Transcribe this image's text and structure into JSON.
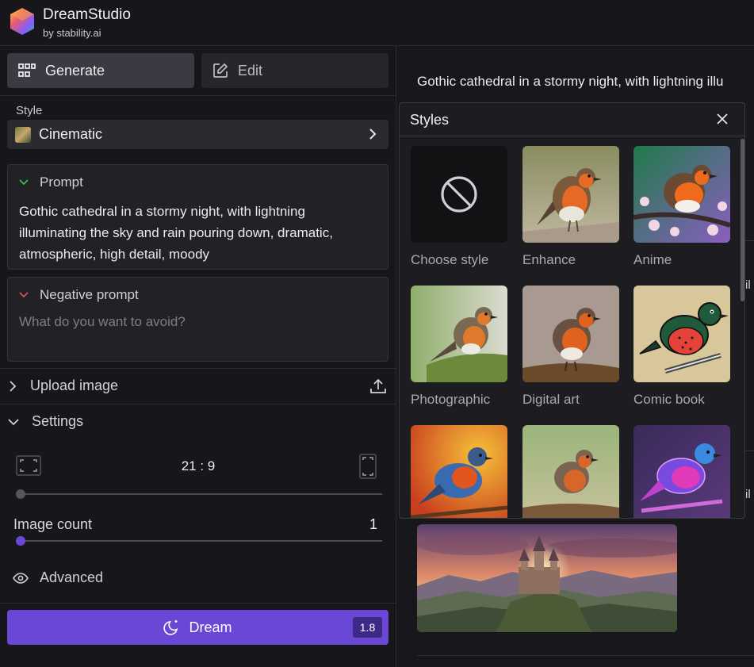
{
  "header": {
    "brand_name": "DreamStudio",
    "brand_sub": "by stability.ai"
  },
  "tabs": {
    "generate": "Generate",
    "edit": "Edit",
    "active": "Generate"
  },
  "style": {
    "label": "Style",
    "selected": "Cinematic"
  },
  "prompt": {
    "heading": "Prompt",
    "text": "Gothic cathedral in a stormy night, with lightning illuminating the sky and rain pouring down, dramatic, atmospheric, high detail, moody"
  },
  "negative_prompt": {
    "heading": "Negative prompt",
    "placeholder": "What do you want to avoid?",
    "value": ""
  },
  "upload": {
    "label": "Upload image"
  },
  "settings": {
    "label": "Settings",
    "aspect_ratio": "21 : 9",
    "aspect_ratio_fraction": 0.0,
    "image_count_label": "Image count",
    "image_count": "1",
    "image_count_fraction": 0.0,
    "advanced_label": "Advanced"
  },
  "dream": {
    "label": "Dream",
    "credits": "1.8"
  },
  "right": {
    "prompt_preview": "Gothic cathedral in a stormy night, with lightning illu",
    "edge_text_1": "il",
    "edge_text_2": "il"
  },
  "styles_panel": {
    "title": "Styles",
    "items": [
      {
        "label": "Choose style"
      },
      {
        "label": "Enhance"
      },
      {
        "label": "Anime"
      },
      {
        "label": "Photographic"
      },
      {
        "label": "Digital art"
      },
      {
        "label": "Comic book"
      },
      {
        "label": ""
      },
      {
        "label": ""
      },
      {
        "label": ""
      }
    ]
  },
  "colors": {
    "accent": "#6b47d6",
    "background": "#17171b",
    "panel": "#212126"
  }
}
